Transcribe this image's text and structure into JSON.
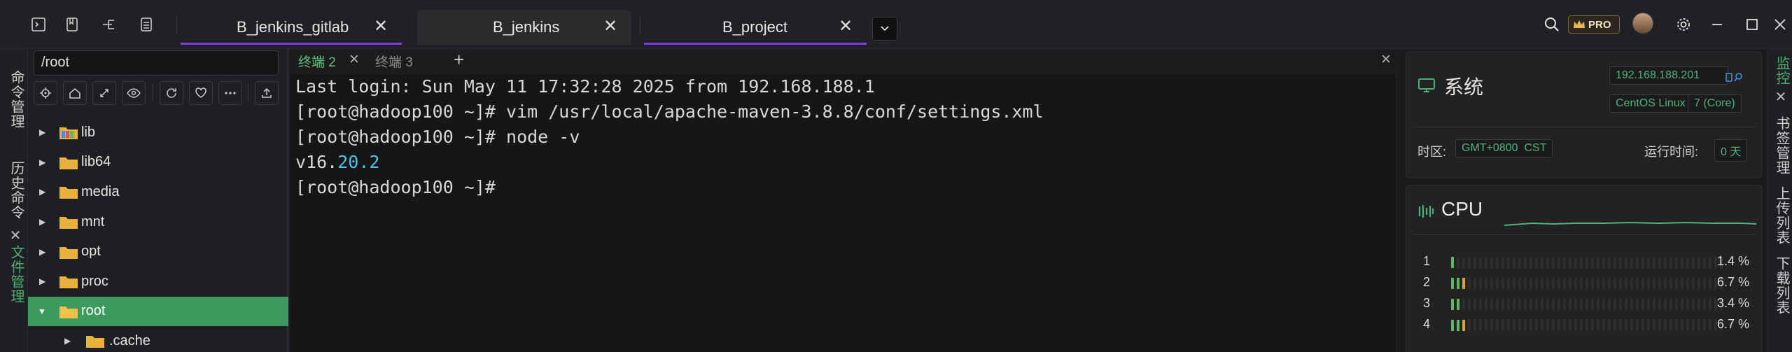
{
  "window_tabs": [
    {
      "label": "B_jenkins_gitlab",
      "close": "✕"
    },
    {
      "label": "B_jenkins",
      "close": "✕"
    },
    {
      "label": "B_project",
      "close": "✕"
    }
  ],
  "pro_label": "PRO",
  "left_rail": {
    "items": [
      "命令管理",
      "历史命令",
      "文件管理"
    ],
    "close_glyph": "✕"
  },
  "file_panel": {
    "path": "/root",
    "tree": [
      {
        "name": "lib",
        "color": "multi"
      },
      {
        "name": "lib64",
        "color": "#e8b13a"
      },
      {
        "name": "media",
        "color": "#e8b13a"
      },
      {
        "name": "mnt",
        "color": "#e8b13a"
      },
      {
        "name": "opt",
        "color": "#e8b13a"
      },
      {
        "name": "proc",
        "color": "#e8b13a"
      },
      {
        "name": "root",
        "color": "#e8b13a"
      },
      {
        "name": ".cache",
        "color": "#e8b13a"
      }
    ]
  },
  "terminal": {
    "tabs": [
      {
        "label": "终端 2",
        "close": "✕"
      },
      {
        "label": "终端 3"
      }
    ],
    "add": "+",
    "close_all": "✕",
    "lines": [
      "Last login: Sun May 11 17:32:28 2025 from 192.168.188.1",
      "[root@hadoop100 ~]# vim /usr/local/apache-maven-3.8.8/conf/settings.xml",
      "[root@hadoop100 ~]# node -v"
    ],
    "version_prefix": "v16.",
    "version_highlight": "20.2",
    "prompt": "[root@hadoop100 ~]#"
  },
  "system": {
    "title": "系统",
    "ip": "192.168.188.201",
    "os": "CentOS Linux",
    "cores": "7 (Core)",
    "timezone_label": "时区:",
    "timezone": "GMT+0800  CST",
    "uptime_label": "运行时间:",
    "uptime": "0 天"
  },
  "cpu": {
    "title": "CPU",
    "cores": [
      {
        "index": "1",
        "percent": "1.4 %",
        "value": 1.4
      },
      {
        "index": "2",
        "percent": "6.7 %",
        "value": 6.7
      },
      {
        "index": "3",
        "percent": "3.4 %",
        "value": 3.4
      },
      {
        "index": "4",
        "percent": "6.7 %",
        "value": 6.7
      }
    ]
  },
  "right_rail": {
    "items": [
      "监控",
      "书签管理",
      "上传列表",
      "下载列表"
    ],
    "close_glyph": "✕"
  },
  "colors": {
    "accent_green": "#3c9a5f",
    "tab_underline": "#7c3aed",
    "folder": "#e8b13a"
  }
}
